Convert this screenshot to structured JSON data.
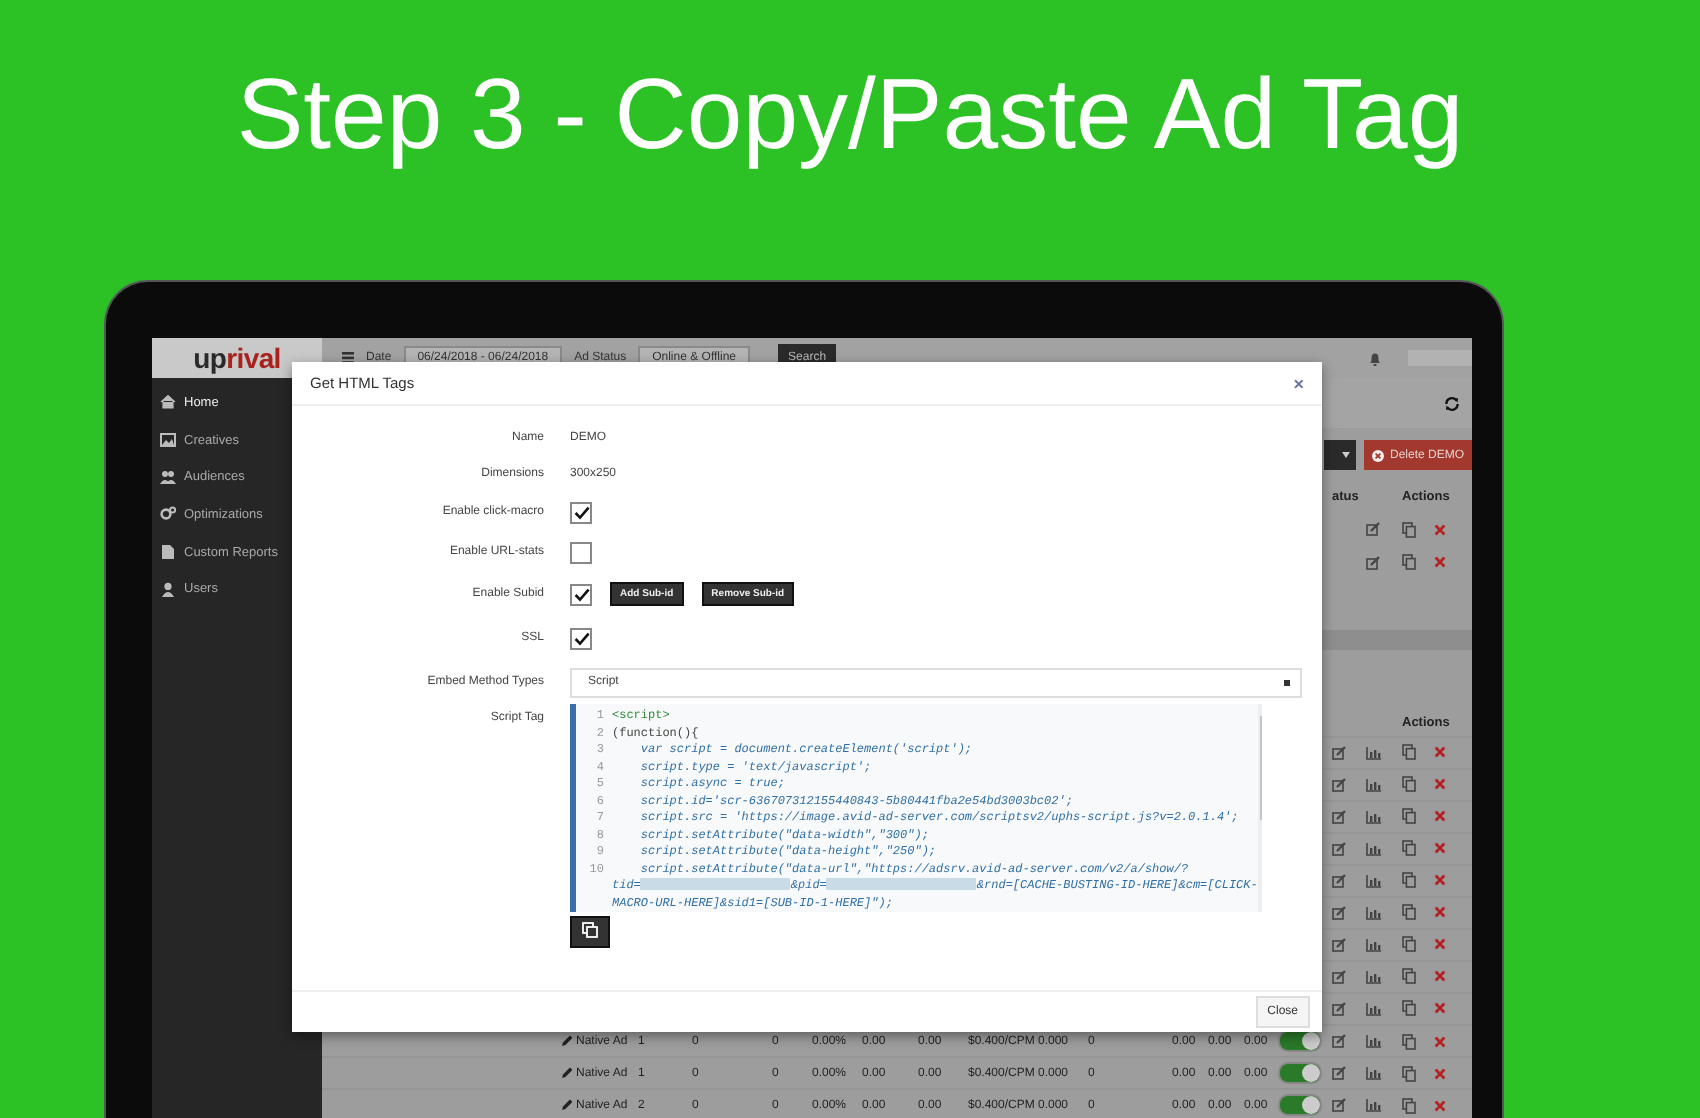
{
  "headline": "Step 3 - Copy/Paste Ad Tag",
  "app": {
    "logo_dark": "up",
    "logo_accent": "rival",
    "toolbar": {
      "date_label": "Date",
      "date_value": "06/24/2018 - 06/24/2018",
      "status_label": "Ad Status",
      "status_value": "Online & Offline",
      "search_button": "Search"
    },
    "sidebar": [
      {
        "label": "Home",
        "selected": true
      },
      {
        "label": "Creatives",
        "selected": false
      },
      {
        "label": "Audiences",
        "selected": false
      },
      {
        "label": "Optimizations",
        "selected": false
      },
      {
        "label": "Custom Reports",
        "selected": false
      },
      {
        "label": "Users",
        "selected": false
      }
    ],
    "delete_button": "Delete DEMO",
    "top_table": {
      "status_header": "atus",
      "actions_header": "Actions",
      "rows": [
        {
          "kind": "actions"
        },
        {
          "kind": "actions"
        }
      ]
    },
    "bottom_table": {
      "actions_header": "Actions",
      "rows": [
        {
          "kind": "actions"
        },
        {
          "kind": "actions"
        },
        {
          "kind": "actions"
        },
        {
          "kind": "actions"
        },
        {
          "kind": "actions"
        },
        {
          "kind": "actions"
        },
        {
          "kind": "actions"
        },
        {
          "kind": "actions"
        },
        {
          "kind": "actions"
        },
        {
          "kind": "ad",
          "cells": [
            "Native Ad",
            "1",
            "0",
            "0",
            "0.00%",
            "0.00",
            "0.00",
            "$0.400/CPM",
            "0.000",
            "0",
            "0.00",
            "0.00",
            "0.00"
          ],
          "on": true
        },
        {
          "kind": "ad",
          "cells": [
            "Native Ad",
            "1",
            "0",
            "0",
            "0.00%",
            "0.00",
            "0.00",
            "$0.400/CPM",
            "0.000",
            "0",
            "0.00",
            "0.00",
            "0.00"
          ],
          "on": true
        },
        {
          "kind": "ad",
          "cells": [
            "Native Ad",
            "2",
            "0",
            "0",
            "0.00%",
            "0.00",
            "0.00",
            "$0.400/CPM",
            "0.000",
            "0",
            "0.00",
            "0.00",
            "0.00"
          ],
          "on": true
        }
      ]
    }
  },
  "modal": {
    "title": "Get HTML Tags",
    "close_icon": "×",
    "fields": [
      {
        "kind": "text",
        "label": "Name",
        "value": "DEMO"
      },
      {
        "kind": "text",
        "label": "Dimensions",
        "value": "300x250"
      },
      {
        "kind": "checkbox",
        "label": "Enable click-macro",
        "checked": true
      },
      {
        "kind": "checkbox",
        "label": "Enable URL-stats",
        "checked": false
      },
      {
        "kind": "checkbox",
        "label": "Enable Subid",
        "checked": true,
        "buttons": [
          "Add Sub-id",
          "Remove Sub-id"
        ]
      },
      {
        "kind": "checkbox",
        "label": "SSL",
        "checked": true
      },
      {
        "kind": "select",
        "label": "Embed Method Types",
        "value": "Script"
      },
      {
        "kind": "code",
        "label": "Script Tag",
        "lines": [
          {
            "number": "1",
            "parts": [
              {
                "kind": "tag",
                "text": "<script>"
              }
            ]
          },
          {
            "number": "2",
            "parts": [
              {
                "kind": "plain",
                "text": "(function(){"
              }
            ]
          },
          {
            "number": "3",
            "parts": [
              {
                "kind": "code",
                "text": "    var script = document.createElement('script');"
              }
            ]
          },
          {
            "number": "4",
            "parts": [
              {
                "kind": "code",
                "text": "    script.type = 'text/javascript';"
              }
            ]
          },
          {
            "number": "5",
            "parts": [
              {
                "kind": "code",
                "text": "    script.async = true;"
              }
            ]
          },
          {
            "number": "6",
            "parts": [
              {
                "kind": "code",
                "text": "    script.id='scr-636707312155440843-5b80441fba2e54bd3003bc02';"
              }
            ]
          },
          {
            "number": "7",
            "parts": [
              {
                "kind": "code",
                "text": "    script.src = 'https://image.avid-ad-server.com/scriptsv2/uphs-script.js?v=2.0.1.4';"
              }
            ]
          },
          {
            "number": "8",
            "parts": [
              {
                "kind": "code",
                "text": "    script.setAttribute(\"data-width\",\"300\");"
              }
            ]
          },
          {
            "number": "9",
            "parts": [
              {
                "kind": "code",
                "text": "    script.setAttribute(\"data-height\",\"250\");"
              }
            ]
          },
          {
            "number": "10",
            "parts": [
              {
                "kind": "code",
                "text": "    script.setAttribute(\"data-url\",\"https://adsrv.avid-ad-server.com/v2/a/show/?"
              },
              {
                "kind": "break"
              },
              {
                "kind": "code",
                "text": "tid="
              },
              {
                "kind": "redacted"
              },
              {
                "kind": "code",
                "text": "&pid="
              },
              {
                "kind": "redacted"
              },
              {
                "kind": "code",
                "text": "&rnd=[CACHE-BUSTING-ID-HERE]&cm=[CLICK-"
              },
              {
                "kind": "break"
              },
              {
                "kind": "code",
                "text": "MACRO-URL-HERE]&sid1=[SUB-ID-1-HERE]\");"
              }
            ]
          }
        ]
      }
    ],
    "close_button": "Close"
  }
}
